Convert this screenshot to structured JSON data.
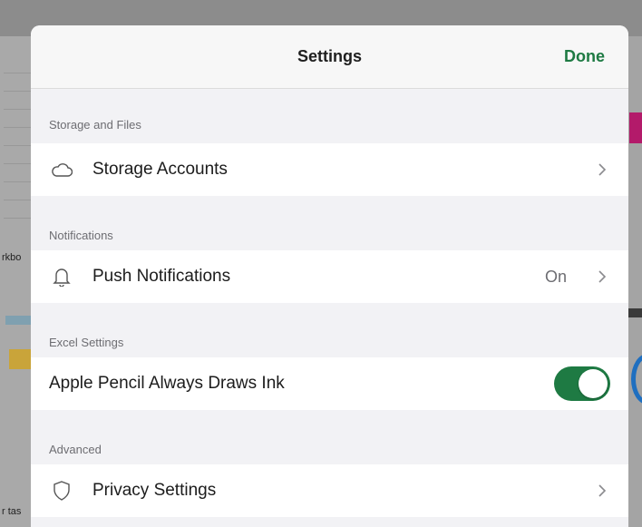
{
  "background": {
    "left_texts": [
      "rkbo",
      "r tas"
    ]
  },
  "header": {
    "title": "Settings",
    "done_label": "Done",
    "accent_color": "#1e7a43"
  },
  "sections": [
    {
      "header": "Storage and Files",
      "rows": [
        {
          "icon": "cloud-icon",
          "label": "Storage Accounts",
          "value": "",
          "chevron": true
        }
      ]
    },
    {
      "header": "Notifications",
      "rows": [
        {
          "icon": "bell-icon",
          "label": "Push Notifications",
          "value": "On",
          "chevron": true
        }
      ]
    },
    {
      "header": "Excel Settings",
      "rows": [
        {
          "icon": "",
          "label": "Apple Pencil Always Draws Ink",
          "toggle": true,
          "toggle_on": true
        }
      ]
    },
    {
      "header": "Advanced",
      "rows": [
        {
          "icon": "shield-icon",
          "label": "Privacy Settings",
          "value": "",
          "chevron": true
        }
      ]
    }
  ]
}
